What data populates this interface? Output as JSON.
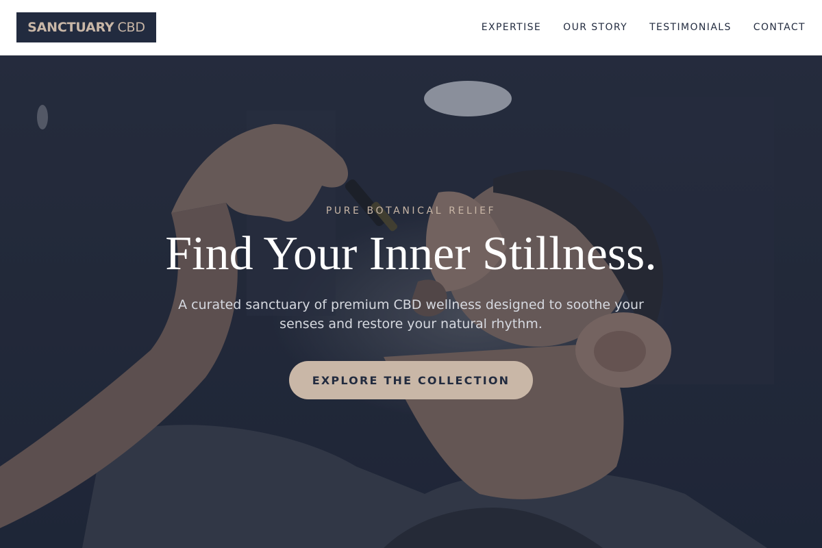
{
  "header": {
    "logo": {
      "brand": "SANCTUARY",
      "suffix": "CBD"
    },
    "nav": [
      "EXPERTISE",
      "OUR STORY",
      "TESTIMONIALS",
      "CONTACT"
    ]
  },
  "hero": {
    "eyebrow": "PURE BOTANICAL RELIEF",
    "headline": "Find Your Inner Stillness.",
    "subhead": "A curated sanctuary of premium CBD wellness designed to soothe your senses and restore your natural rhythm.",
    "cta_label": "EXPLORE THE COLLECTION"
  },
  "colors": {
    "navy": "#222b3f",
    "accent": "#c9b7a7",
    "white": "#ffffff"
  }
}
